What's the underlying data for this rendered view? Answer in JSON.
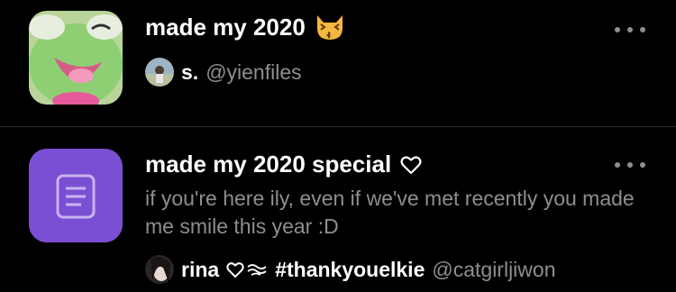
{
  "playlists": [
    {
      "title": "made my 2020",
      "title_emoji_icon": "kissing-cat-emoji-icon",
      "more_icon": "more-dots-icon",
      "author": {
        "name": "s.",
        "handle": "@yienfiles"
      }
    },
    {
      "title": "made my 2020 special",
      "title_icon": "heart-outline-icon",
      "description": "if you're here ily, even if we've met recently you made me smile this year :D",
      "more_icon": "more-dots-icon",
      "author": {
        "name": "rina",
        "hashtag": "#thankyouelkie",
        "handle": "@catgirljiwon"
      }
    }
  ],
  "colors": {
    "background": "#000000",
    "primary_text": "#ffffff",
    "secondary_text": "#8e8e93",
    "note_thumb": "#7b4fd3",
    "divider": "#2b2b2f"
  }
}
